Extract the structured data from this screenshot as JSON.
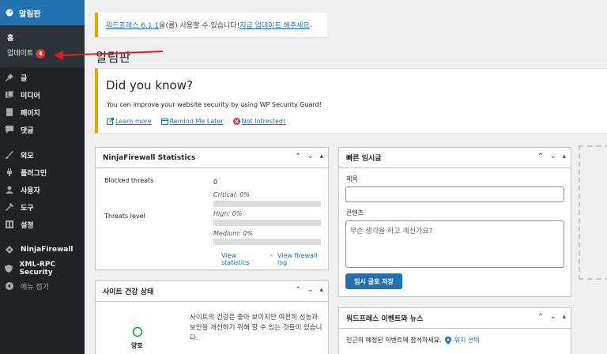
{
  "sidebar": {
    "dashboard_label": "알림판",
    "submenu": [
      "홈",
      "업데이트"
    ],
    "update_count": "4",
    "items": [
      "글",
      "미디어",
      "페이지",
      "댓글",
      "외모",
      "플러그인",
      "사용자",
      "도구",
      "설정",
      "NinjaFirewall",
      "XML-RPC Security",
      "메뉴 접기"
    ]
  },
  "notice": {
    "text_before": "워드프레스 6.1.1",
    "text_middle": "을(를) 사용할 수 있습니다! ",
    "link": "지금 업데이트 해주세요",
    "text_after": "."
  },
  "page_title": "알림판",
  "did_you_know": {
    "title": "Did you know?",
    "body": "You can improve your website security by using WP Security Guard!",
    "learn_more": "Learn more",
    "remind": "Remind Me Later",
    "not_interested": "Not Intrested!"
  },
  "ninja": {
    "title": "NinjaFirewall Statistics",
    "blocked_label": "Blocked threats",
    "blocked_value": "0",
    "threats_label": "Threats level",
    "critical": "Critical: 0%",
    "high": "High: 0%",
    "medium": "Medium: 0%",
    "view_stats": "View statistics",
    "sep": "-",
    "view_log": "View firewall log",
    "critical_fill": 0,
    "high_fill": 0,
    "medium_fill": 0
  },
  "quick_draft": {
    "title": "빠른 임시글",
    "title_label": "제목",
    "content_label": "콘텐츠",
    "content_placeholder": "무슨 생각을 하고 계신가요?",
    "save_button": "임시 글로 저장"
  },
  "site_health": {
    "title": "사이트 건강 상태",
    "status": "양호",
    "text": "사이트의 건강은 좋아 보이지만 여전히 성능과 보안을 개선하기 위해 할 수 있는 것들이 있습니다."
  },
  "events": {
    "title": "워드프레스 이벤트와 뉴스",
    "text": "인근의 예정된 이벤트에 참석하세요.",
    "location_link": "위치 선택"
  },
  "colors": {
    "sidebar_bg": "#1d2327",
    "active": "#2271b1",
    "badge": "#d63638",
    "notice_border": "#dba617",
    "health_green": "#00a32a"
  }
}
